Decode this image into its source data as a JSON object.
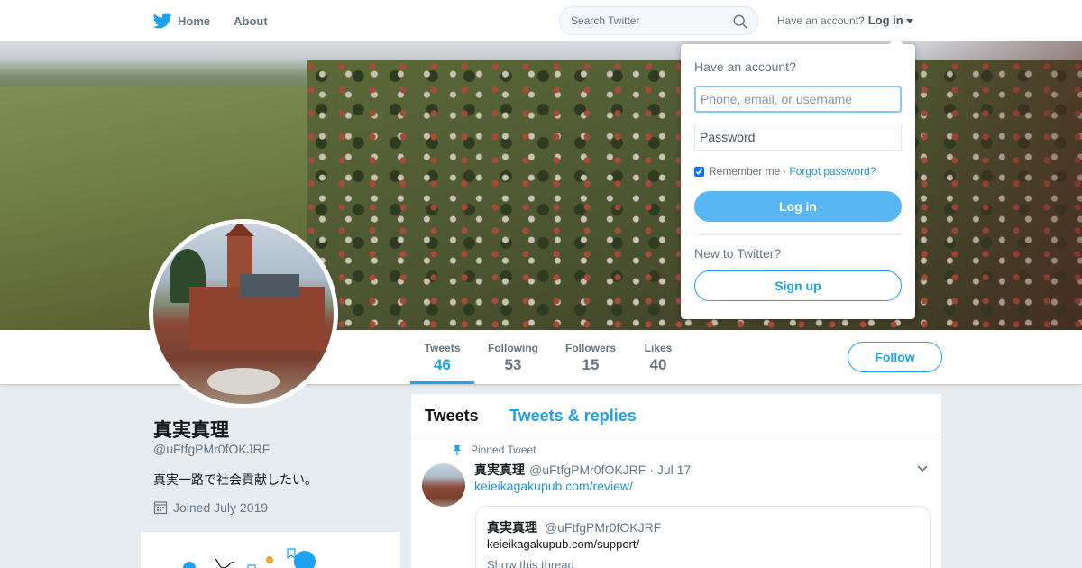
{
  "nav": {
    "home_label": "Home",
    "about_label": "About",
    "search_placeholder": "Search Twitter",
    "have_account_label": "Have an account?",
    "login_label": "Log in"
  },
  "profile": {
    "name": "真実真理",
    "handle": "@uFtfgPMr0fOKJRF",
    "bio": "真実一路で社会貢献したい。",
    "joined": "Joined July 2019",
    "follow_label": "Follow",
    "stats": [
      {
        "label": "Tweets",
        "value": "46",
        "active": true
      },
      {
        "label": "Following",
        "value": "53",
        "active": false
      },
      {
        "label": "Followers",
        "value": "15",
        "active": false
      },
      {
        "label": "Likes",
        "value": "40",
        "active": false
      }
    ]
  },
  "timeline": {
    "tabs": [
      "Tweets",
      "Tweets & replies"
    ],
    "pinned_label": "Pinned Tweet",
    "tweet": {
      "name": "真実真理",
      "handle": "@uFtfgPMr0fOKJRF",
      "date": "· Jul 17",
      "link": "keieikagakupub.com/review/",
      "quote": {
        "name": "真実真理",
        "handle": "@uFtfgPMr0fOKJRF",
        "text": "keieikagakupub.com/support/",
        "thread_label": "Show this thread"
      }
    }
  },
  "login_dropdown": {
    "title": "Have an account?",
    "username_placeholder": "Phone, email, or username",
    "password_placeholder": "Password",
    "remember_label": "Remember me",
    "separator": "·",
    "forgot_label": "Forgot password?",
    "login_button": "Log in",
    "new_label": "New to Twitter?",
    "signup_button": "Sign up"
  },
  "colors": {
    "accent": "#1da1f2",
    "link": "#1b95e0",
    "background": "#e6ecf0"
  }
}
